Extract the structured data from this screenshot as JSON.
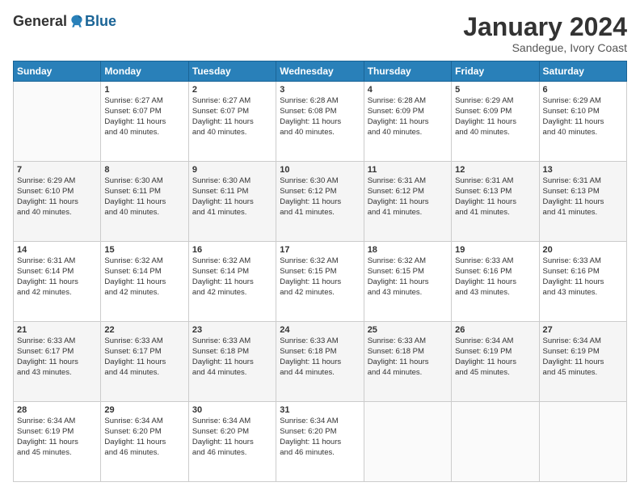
{
  "logo": {
    "general": "General",
    "blue": "Blue"
  },
  "title": {
    "month_year": "January 2024",
    "location": "Sandegue, Ivory Coast"
  },
  "days_of_week": [
    "Sunday",
    "Monday",
    "Tuesday",
    "Wednesday",
    "Thursday",
    "Friday",
    "Saturday"
  ],
  "weeks": [
    [
      {
        "day": "",
        "info": ""
      },
      {
        "day": "1",
        "info": "Sunrise: 6:27 AM\nSunset: 6:07 PM\nDaylight: 11 hours\nand 40 minutes."
      },
      {
        "day": "2",
        "info": "Sunrise: 6:27 AM\nSunset: 6:07 PM\nDaylight: 11 hours\nand 40 minutes."
      },
      {
        "day": "3",
        "info": "Sunrise: 6:28 AM\nSunset: 6:08 PM\nDaylight: 11 hours\nand 40 minutes."
      },
      {
        "day": "4",
        "info": "Sunrise: 6:28 AM\nSunset: 6:09 PM\nDaylight: 11 hours\nand 40 minutes."
      },
      {
        "day": "5",
        "info": "Sunrise: 6:29 AM\nSunset: 6:09 PM\nDaylight: 11 hours\nand 40 minutes."
      },
      {
        "day": "6",
        "info": "Sunrise: 6:29 AM\nSunset: 6:10 PM\nDaylight: 11 hours\nand 40 minutes."
      }
    ],
    [
      {
        "day": "7",
        "info": "Sunrise: 6:29 AM\nSunset: 6:10 PM\nDaylight: 11 hours\nand 40 minutes."
      },
      {
        "day": "8",
        "info": "Sunrise: 6:30 AM\nSunset: 6:11 PM\nDaylight: 11 hours\nand 40 minutes."
      },
      {
        "day": "9",
        "info": "Sunrise: 6:30 AM\nSunset: 6:11 PM\nDaylight: 11 hours\nand 41 minutes."
      },
      {
        "day": "10",
        "info": "Sunrise: 6:30 AM\nSunset: 6:12 PM\nDaylight: 11 hours\nand 41 minutes."
      },
      {
        "day": "11",
        "info": "Sunrise: 6:31 AM\nSunset: 6:12 PM\nDaylight: 11 hours\nand 41 minutes."
      },
      {
        "day": "12",
        "info": "Sunrise: 6:31 AM\nSunset: 6:13 PM\nDaylight: 11 hours\nand 41 minutes."
      },
      {
        "day": "13",
        "info": "Sunrise: 6:31 AM\nSunset: 6:13 PM\nDaylight: 11 hours\nand 41 minutes."
      }
    ],
    [
      {
        "day": "14",
        "info": "Sunrise: 6:31 AM\nSunset: 6:14 PM\nDaylight: 11 hours\nand 42 minutes."
      },
      {
        "day": "15",
        "info": "Sunrise: 6:32 AM\nSunset: 6:14 PM\nDaylight: 11 hours\nand 42 minutes."
      },
      {
        "day": "16",
        "info": "Sunrise: 6:32 AM\nSunset: 6:14 PM\nDaylight: 11 hours\nand 42 minutes."
      },
      {
        "day": "17",
        "info": "Sunrise: 6:32 AM\nSunset: 6:15 PM\nDaylight: 11 hours\nand 42 minutes."
      },
      {
        "day": "18",
        "info": "Sunrise: 6:32 AM\nSunset: 6:15 PM\nDaylight: 11 hours\nand 43 minutes."
      },
      {
        "day": "19",
        "info": "Sunrise: 6:33 AM\nSunset: 6:16 PM\nDaylight: 11 hours\nand 43 minutes."
      },
      {
        "day": "20",
        "info": "Sunrise: 6:33 AM\nSunset: 6:16 PM\nDaylight: 11 hours\nand 43 minutes."
      }
    ],
    [
      {
        "day": "21",
        "info": "Sunrise: 6:33 AM\nSunset: 6:17 PM\nDaylight: 11 hours\nand 43 minutes."
      },
      {
        "day": "22",
        "info": "Sunrise: 6:33 AM\nSunset: 6:17 PM\nDaylight: 11 hours\nand 44 minutes."
      },
      {
        "day": "23",
        "info": "Sunrise: 6:33 AM\nSunset: 6:18 PM\nDaylight: 11 hours\nand 44 minutes."
      },
      {
        "day": "24",
        "info": "Sunrise: 6:33 AM\nSunset: 6:18 PM\nDaylight: 11 hours\nand 44 minutes."
      },
      {
        "day": "25",
        "info": "Sunrise: 6:33 AM\nSunset: 6:18 PM\nDaylight: 11 hours\nand 44 minutes."
      },
      {
        "day": "26",
        "info": "Sunrise: 6:34 AM\nSunset: 6:19 PM\nDaylight: 11 hours\nand 45 minutes."
      },
      {
        "day": "27",
        "info": "Sunrise: 6:34 AM\nSunset: 6:19 PM\nDaylight: 11 hours\nand 45 minutes."
      }
    ],
    [
      {
        "day": "28",
        "info": "Sunrise: 6:34 AM\nSunset: 6:19 PM\nDaylight: 11 hours\nand 45 minutes."
      },
      {
        "day": "29",
        "info": "Sunrise: 6:34 AM\nSunset: 6:20 PM\nDaylight: 11 hours\nand 46 minutes."
      },
      {
        "day": "30",
        "info": "Sunrise: 6:34 AM\nSunset: 6:20 PM\nDaylight: 11 hours\nand 46 minutes."
      },
      {
        "day": "31",
        "info": "Sunrise: 6:34 AM\nSunset: 6:20 PM\nDaylight: 11 hours\nand 46 minutes."
      },
      {
        "day": "",
        "info": ""
      },
      {
        "day": "",
        "info": ""
      },
      {
        "day": "",
        "info": ""
      }
    ]
  ]
}
